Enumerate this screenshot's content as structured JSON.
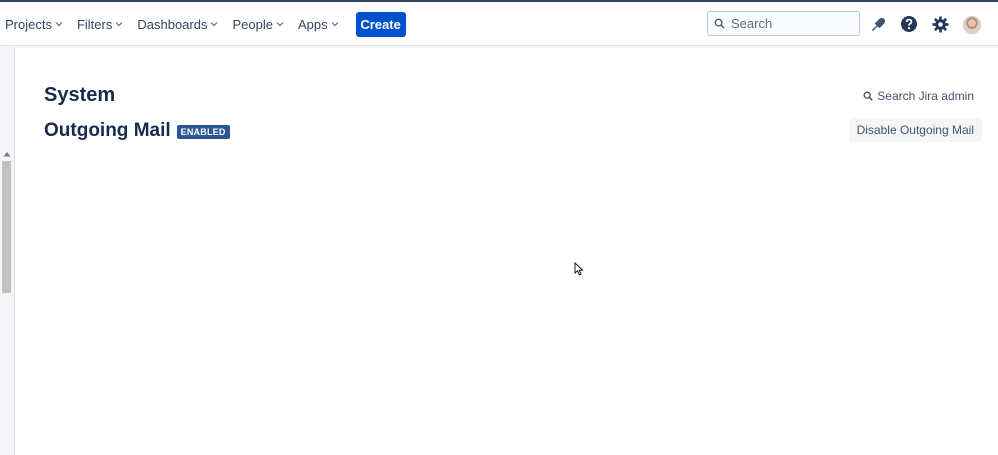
{
  "header": {
    "nav": [
      {
        "label": "Projects"
      },
      {
        "label": "Filters"
      },
      {
        "label": "Dashboards"
      },
      {
        "label": "People"
      },
      {
        "label": "Apps"
      }
    ],
    "create_label": "Create",
    "search": {
      "placeholder": "Search"
    },
    "icons": [
      "notifications-icon",
      "help-icon",
      "settings-icon",
      "avatar"
    ]
  },
  "main": {
    "title": "System",
    "subtitle": "Outgoing Mail",
    "status_badge": "ENABLED",
    "admin_search_label": "Search Jira admin",
    "disable_button": "Disable Outgoing Mail"
  },
  "colors": {
    "primary": "#0052cc",
    "badge": "#2b5797",
    "text": "#172b4d"
  }
}
